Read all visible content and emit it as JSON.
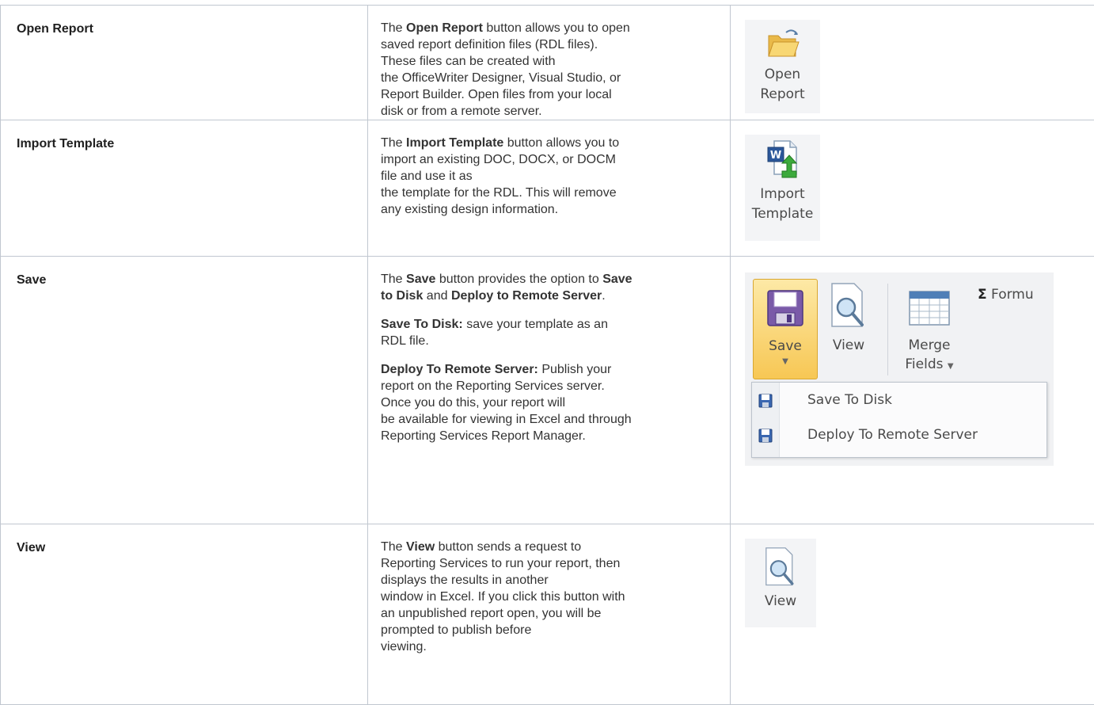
{
  "rows": [
    {
      "feature": "Open Report",
      "desc_html": "<span class=\"line\">The <b>Open Report</b> button allows you to open</span><span class=\"line\">saved report definition files (RDL files).</span><span class=\"line\">These files can be created with</span><span class=\"line\">the OfficeWriter Designer, Visual Studio, or</span><span class=\"line\">Report Builder. Open files from your local</span><span class=\"line\">disk or from a remote server.</span>",
      "button": {
        "line1": "Open",
        "line2": "Report",
        "icon": "folder-open-icon"
      }
    },
    {
      "feature": "Import Template",
      "desc_html": "<span class=\"line\">The <b>Import Template</b> button allows you to</span><span class=\"line\">import an existing DOC, DOCX, or DOCM</span><span class=\"line\">file and use it as</span><span class=\"line\">the template for the RDL. This will remove</span><span class=\"line\">any existing design information.</span>",
      "button": {
        "line1": "Import",
        "line2": "Template",
        "icon": "word-import-icon"
      }
    },
    {
      "feature": "Save",
      "desc_html": "<p><span class=\"line\">The <b>Save</b> button provides the option to <b>Save</b></span><span class=\"line\"><b>to Disk</b> and <b>Deploy to Remote Server</b>.</span></p><p><span class=\"line\"><b>Save To Disk:</b> save your template as an</span><span class=\"line\">RDL file.</span></p><p><span class=\"line\"><b>Deploy To Remote Server:</b> Publish your</span><span class=\"line\">report on the Reporting Services server.</span><span class=\"line\">Once you do this, your report will</span><span class=\"line\">be available for viewing in Excel and through</span><span class=\"line\">Reporting Services Report Manager.</span></p>",
      "ribbon": {
        "save_label": "Save",
        "view_label": "View",
        "merge_line1": "Merge",
        "merge_line2": "Fields",
        "formula_label": "Formu",
        "menu": [
          "Save To Disk",
          "Deploy To Remote Server"
        ]
      }
    },
    {
      "feature": "View",
      "desc_html": "<span class=\"line\">The <b>View</b> button sends a request to</span><span class=\"line\">Reporting Services to run your report, then</span><span class=\"line\">displays the results in another</span><span class=\"line\">window in Excel. If you click this button with</span><span class=\"line\">an unpublished report open, you will be</span><span class=\"line\">prompted to publish before</span><span class=\"line\">viewing.</span>",
      "button": {
        "line1": "View",
        "icon": "magnifier-doc-icon"
      }
    }
  ],
  "colors": {
    "border": "#c1c7d0",
    "text": "#333333",
    "save_highlight": "#f7c754"
  }
}
